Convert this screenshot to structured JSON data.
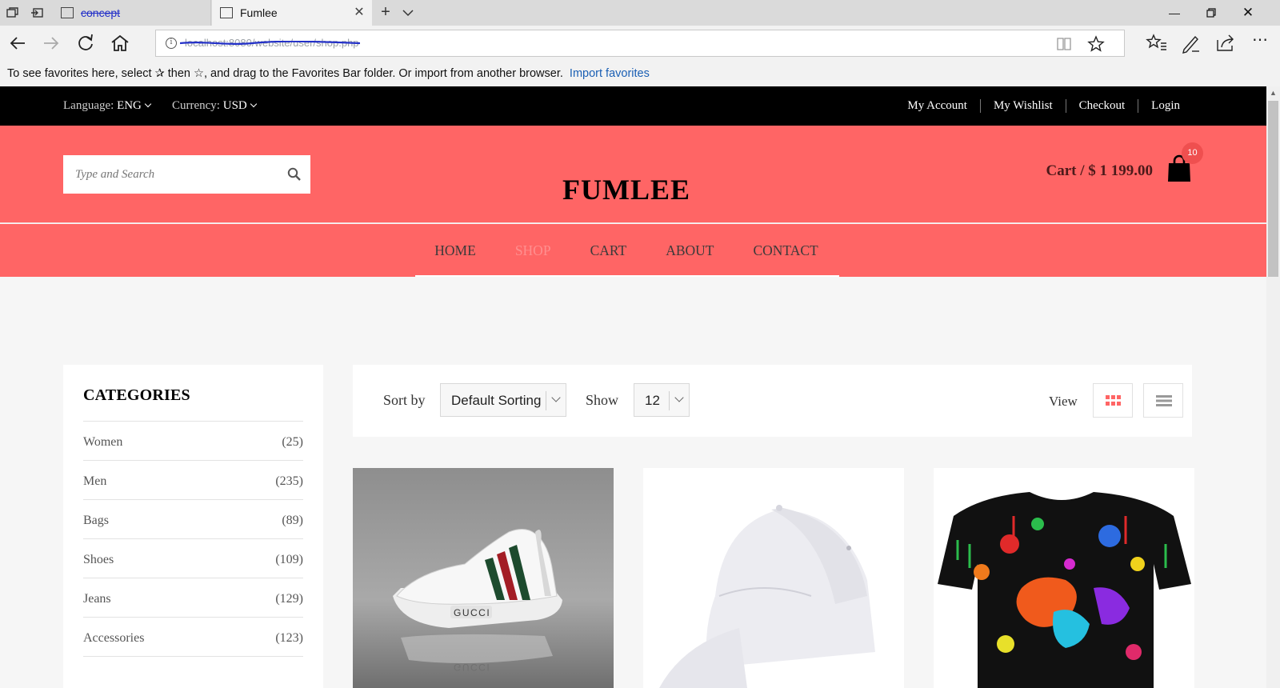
{
  "browser": {
    "tabs": [
      {
        "title": "concept",
        "active": false
      },
      {
        "title": "Fumlee",
        "active": true
      }
    ],
    "address_url": "localhost:8080/website/user/shop.php",
    "favorites_bar": {
      "message": "To see favorites here, select  ✰  then ☆, and drag to the Favorites Bar folder. Or import from another browser.",
      "import_link": "Import favorites"
    }
  },
  "topbar": {
    "language_label": "Language:",
    "language_value": "ENG",
    "currency_label": "Currency:",
    "currency_value": "USD",
    "links": [
      "My Account",
      "My Wishlist",
      "Checkout",
      "Login"
    ]
  },
  "header": {
    "search_placeholder": "Type and Search",
    "logo": "FUMLEE",
    "cart_text": "Cart / $ 1 199.00",
    "cart_count": "10"
  },
  "menu": {
    "items": [
      "HOME",
      "SHOP",
      "CART",
      "ABOUT",
      "CONTACT"
    ],
    "active": "SHOP"
  },
  "sidebar": {
    "title": "CATEGORIES",
    "categories": [
      {
        "name": "Women",
        "count": "(25)"
      },
      {
        "name": "Men",
        "count": "(235)"
      },
      {
        "name": "Bags",
        "count": "(89)"
      },
      {
        "name": "Shoes",
        "count": "(109)"
      },
      {
        "name": "Jeans",
        "count": "(129)"
      },
      {
        "name": "Accessories",
        "count": "(123)"
      }
    ]
  },
  "toolbar": {
    "sort_label": "Sort by",
    "sort_value": "Default Sorting",
    "show_label": "Show",
    "show_value": "12",
    "view_label": "View",
    "active_view": "grid"
  },
  "products": [
    {
      "image": "white-sneaker-icon",
      "printed_text": [
        "GUCCI",
        "GUCCI"
      ]
    },
    {
      "image": "white-cap-icon"
    },
    {
      "image": "paint-splatter-tshirt-icon"
    }
  ],
  "colors": {
    "header_bg": "#ff6565",
    "topbar_bg": "#000000",
    "menu_active": "#ff8f8f",
    "badge": "#ef4f4f",
    "grid_icon_active": "#ff6565"
  }
}
